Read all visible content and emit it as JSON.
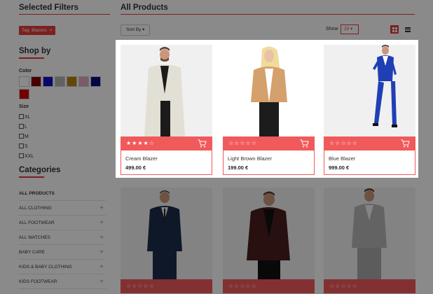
{
  "sidebar": {
    "selected_filters_title": "Selected Filters",
    "tag_label": "Tag: Blazers",
    "tag_remove": "×",
    "shop_by_title": "Shop by",
    "color_label": "Color",
    "colors": [
      "#ffffff",
      "#8b0000",
      "#1010c8",
      "#b5b5b5",
      "#b8860b",
      "#e6a8c0",
      "#0a0a80",
      "#d40000"
    ],
    "size_label": "Size",
    "sizes": [
      "XL",
      "L",
      "M",
      "S",
      "XXL"
    ],
    "categories_title": "Categories",
    "categories": [
      {
        "label": "ALL PRODUCTS",
        "expand": ""
      },
      {
        "label": "ALL CLOTHING",
        "expand": "+"
      },
      {
        "label": "ALL FOOTWEAR",
        "expand": "+"
      },
      {
        "label": "ALL WATCHES",
        "expand": "+"
      },
      {
        "label": "BABY CARE",
        "expand": "+"
      },
      {
        "label": "KIDS & BABY CLOTHING",
        "expand": "+"
      },
      {
        "label": "KIDS FOOTWEAR",
        "expand": "+"
      }
    ]
  },
  "main": {
    "title": "All Products",
    "sort_label": "Sort By ▾",
    "show_label": "Show",
    "show_value": "20 ▾"
  },
  "products": [
    {
      "name": "Cream Blazer",
      "price": "499.00 €",
      "stars": "★★★★☆",
      "rating": 4
    },
    {
      "name": "Light Brown Blazer",
      "price": "199.00 €",
      "stars": "☆☆☆☆☆",
      "rating": 0
    },
    {
      "name": "Blue Blazer",
      "price": "999.00 €",
      "stars": "☆☆☆☆☆",
      "rating": 0
    }
  ],
  "products_row2": [
    {
      "stars": "☆☆☆☆☆"
    },
    {
      "stars": "☆☆☆☆☆"
    },
    {
      "stars": "☆☆☆☆☆"
    }
  ],
  "theme": {
    "accent": "#e43c3c",
    "card_bar": "#f05a5b"
  }
}
